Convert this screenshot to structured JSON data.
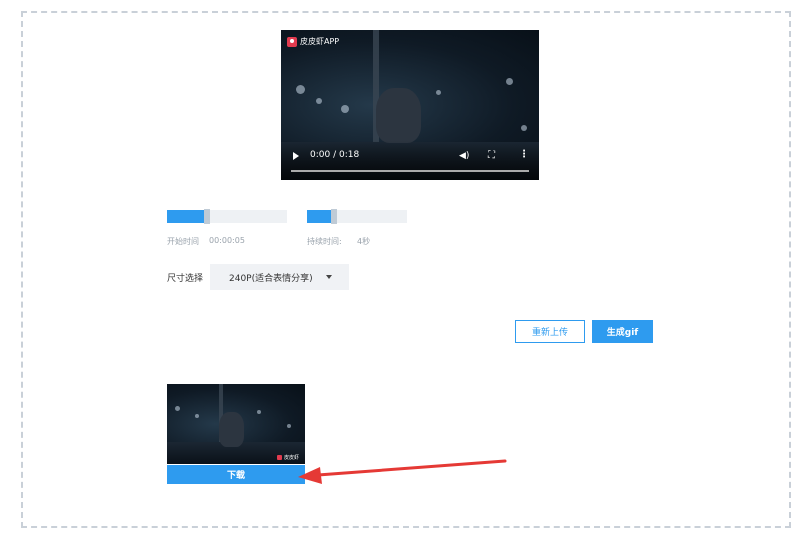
{
  "video": {
    "app_name": "皮皮虾APP",
    "time": "0:00 / 0:18"
  },
  "trim": {
    "start_label": "开始时间",
    "start_value": "00:00:05",
    "duration_label": "持续时间:",
    "duration_value": "4秒"
  },
  "size": {
    "label": "尺寸选择",
    "selected": "240P(适合表情分享)"
  },
  "buttons": {
    "reupload": "重新上传",
    "generate": "生成gif",
    "download": "下载"
  },
  "thumbnail": {
    "watermark": "皮皮虾"
  },
  "colors": {
    "accent": "#2e9bef",
    "arrow": "#e53935",
    "logo": "#e23b4f"
  }
}
